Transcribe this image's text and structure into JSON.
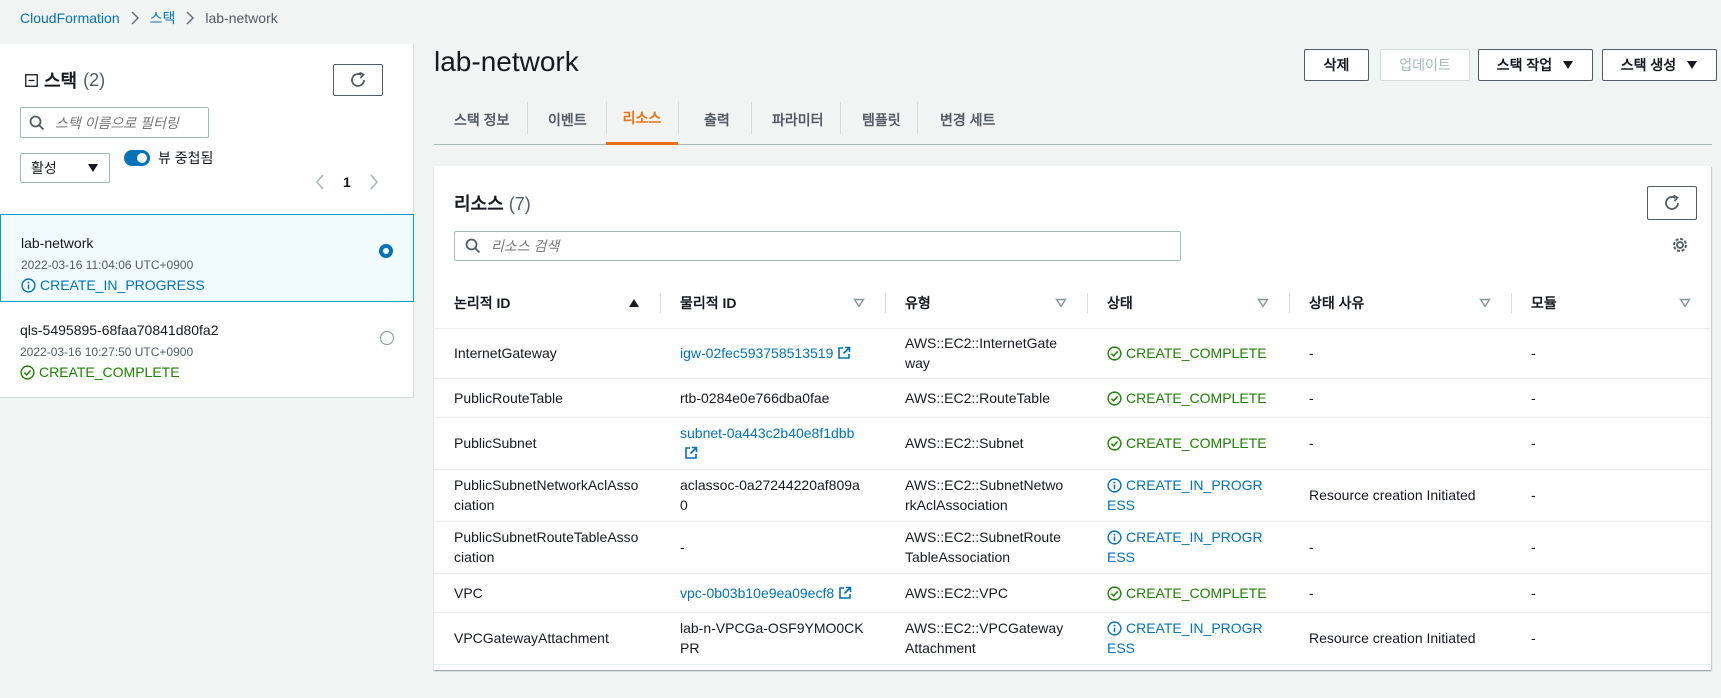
{
  "breadcrumb": {
    "root": "CloudFormation",
    "stacks": "스택",
    "current": "lab-network"
  },
  "left": {
    "title": "스택",
    "count": "(2)",
    "search_placeholder": "스택 이름으로 필터링",
    "filter_value": "활성",
    "toggle_label": "뷰 중첩됨",
    "page": "1",
    "stacks": [
      {
        "name": "lab-network",
        "time": "2022-03-16 11:04:06 UTC+0900",
        "status": "CREATE_IN_PROGRESS",
        "selected": true
      },
      {
        "name": "qls-5495895-68faa70841d80fa2",
        "time": "2022-03-16 10:27:50 UTC+0900",
        "status": "CREATE_COMPLETE",
        "selected": false
      }
    ]
  },
  "header": {
    "title": "lab-network",
    "delete": "삭제",
    "update": "업데이트",
    "stack_actions": "스택 작업",
    "create_stack": "스택 생성"
  },
  "tabs": [
    "스택 정보",
    "이벤트",
    "리소스",
    "출력",
    "파라미터",
    "템플릿",
    "변경 세트"
  ],
  "active_tab": "리소스",
  "resources": {
    "title": "리소스",
    "count": "(7)",
    "search_placeholder": "리소스 검색",
    "columns": [
      "논리적 ID",
      "물리적 ID",
      "유형",
      "상태",
      "상태 사유",
      "모듈"
    ],
    "rows": [
      [
        "InternetGateway",
        "igw-02fec593758513519",
        "AWS::EC2::InternetGateway",
        "CREATE_COMPLETE",
        "-",
        "-"
      ],
      [
        "PublicRouteTable",
        "rtb-0284e0e766dba0fae",
        "AWS::EC2::RouteTable",
        "CREATE_COMPLETE",
        "-",
        "-"
      ],
      [
        "PublicSubnet",
        "subnet-0a443c2b40e8f1dbb",
        "AWS::EC2::Subnet",
        "CREATE_COMPLETE",
        "-",
        "-"
      ],
      [
        "PublicSubnetNetworkAclAssociation",
        "aclassoc-0a27244220af809a0",
        "AWS::EC2::SubnetNetworkAclAssociation",
        "CREATE_IN_PROGRESS",
        "Resource creation Initiated",
        "-"
      ],
      [
        "PublicSubnetRouteTableAssociation",
        "-",
        "AWS::EC2::SubnetRouteTableAssociation",
        "CREATE_IN_PROGRESS",
        "-",
        "-"
      ],
      [
        "VPC",
        "vpc-0b03b10e9ea09ecf8",
        "AWS::EC2::VPC",
        "CREATE_COMPLETE",
        "-",
        "-"
      ],
      [
        "VPCGatewayAttachment",
        "lab-n-VPCGa-OSF9YMO0CKPR",
        "AWS::EC2::VPCGatewayAttachment",
        "CREATE_IN_PROGRESS",
        "Resource creation Initiated",
        "-"
      ]
    ]
  },
  "colors": {
    "link": "#0073bb",
    "success": "#1d8102",
    "accent": "#ec7211"
  }
}
